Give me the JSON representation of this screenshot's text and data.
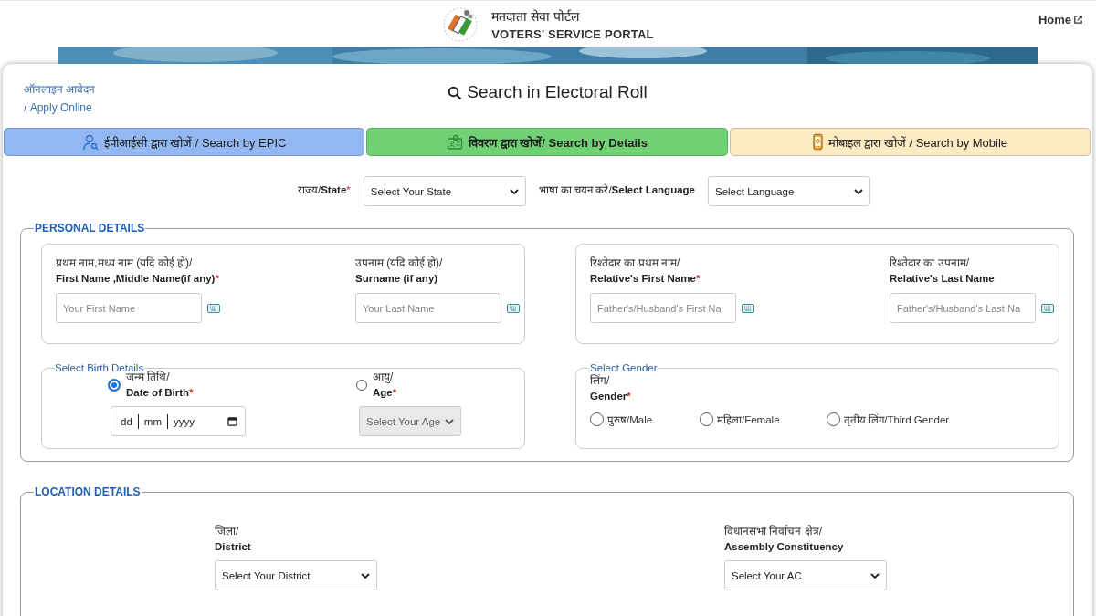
{
  "header": {
    "title_hindi": "मतदाता सेवा पोर्टल",
    "title_english": "VOTERS' SERVICE PORTAL",
    "home_link": "Home"
  },
  "apply_online": {
    "line_1": "ऑनलाइन आवेदन",
    "line_2": "/ Apply Online"
  },
  "page_title": "Search in Electoral Roll",
  "tabs": [
    {
      "kind": "epic",
      "label": "ईपीआईसी द्वारा खोजें / Search by EPIC",
      "color": "#92b7f1",
      "selected": false
    },
    {
      "kind": "details",
      "label": "विवरण द्वारा खोजें/ Search by Details",
      "color": "#6fd173",
      "selected": true
    },
    {
      "kind": "mobile",
      "label": "मोबाइल द्वारा खोजें / Search by Mobile",
      "color": "#fdeac3",
      "selected": false
    }
  ],
  "selectors": [
    {
      "label": "राज्य/**State**",
      "mark": "*",
      "value": "Select Your State"
    },
    {
      "label": "भाषा का चयन करे/**Select Language**",
      "value": "Select Language"
    }
  ],
  "personal_details": {
    "legend": "PERSONAL DETAILS",
    "name_groups": [
      {
        "fields": [
          {
            "label_hindi": "प्रथम नाम,मध्य नाम (यदि कोई हो)/",
            "label_english": "First Name ,Middle Name(if any)",
            "mark": "*",
            "placeholder": "Your First Name"
          },
          {
            "label_hindi": "उपनाम (यदि कोई हो)/",
            "label_english": "Surname (if any)",
            "placeholder": "Your Last Name"
          }
        ]
      },
      {
        "fields": [
          {
            "label_hindi": "रिश्तेदार का प्रथम नाम/",
            "label_english": "Relative's First Name",
            "mark": "*",
            "placeholder": "Father's/Husband's First Na"
          },
          {
            "label_hindi": "रिश्तेदार का उपनाम/",
            "label_english": "Relative's Last Name",
            "placeholder": "Father's/Husband's Last Na"
          }
        ]
      }
    ],
    "birth_details": {
      "legend": "Select Birth Details",
      "options": [
        {
          "kind": "date",
          "label_hindi": "जन्म तिथि/",
          "label_english": "Date of Birth",
          "mark": "*",
          "selected": true,
          "parts": [
            "dd",
            "mm",
            "yyyy"
          ]
        },
        {
          "kind": "select",
          "label_hindi": "आयु/",
          "label_english": "Age",
          "mark": "*",
          "selected": false,
          "value": "Select Your Age",
          "disabled": true
        }
      ]
    },
    "gender": {
      "legend": "Select Gender",
      "label_hindi": "लिंग/",
      "label_english": "Gender",
      "mark": "*",
      "options": [
        {
          "label": "पुरुष/Male",
          "selected": false
        },
        {
          "label": "महिला/Female",
          "selected": false
        },
        {
          "label": "तृतीय लिंग/Third Gender",
          "selected": false
        }
      ]
    }
  },
  "location_details": {
    "legend": "LOCATION DETAILS",
    "fields": [
      {
        "label_hindi": "जिला/",
        "label_english": "District",
        "value": "Select Your District"
      },
      {
        "label_hindi": "विधानसभा निर्वाचन क्षेत्र/",
        "label_english": "Assembly Constituency",
        "value": "Select Your AC"
      }
    ]
  }
}
